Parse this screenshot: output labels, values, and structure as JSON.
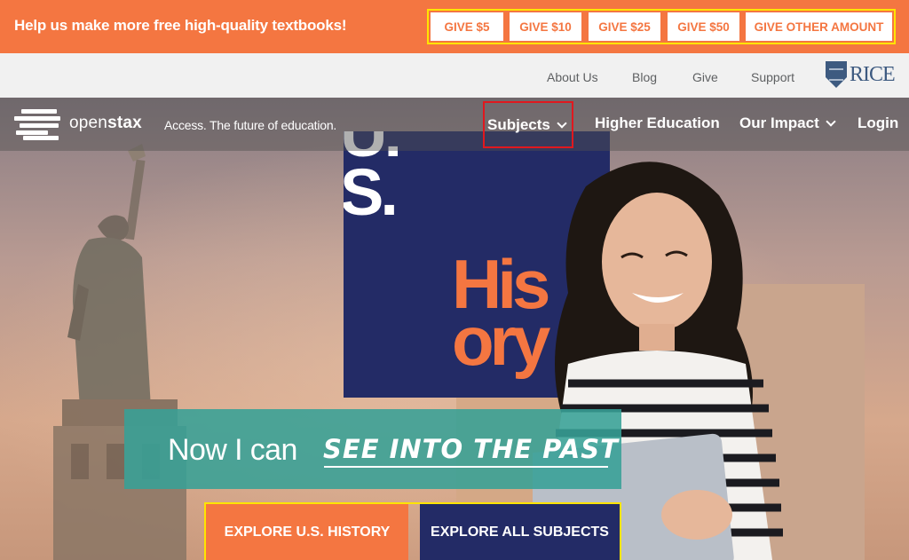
{
  "banner": {
    "message": "Help us make more free high-quality textbooks!",
    "give_buttons": [
      "GIVE $5",
      "GIVE $10",
      "GIVE $25",
      "GIVE $50",
      "GIVE OTHER AMOUNT"
    ]
  },
  "utility_nav": {
    "links": [
      "About Us",
      "Blog",
      "Give",
      "Support"
    ],
    "rice_logo_text": "RICE"
  },
  "main_nav": {
    "logo_text_light": "open",
    "logo_text_bold": "stax",
    "tagline": "Access. The future of education.",
    "items": {
      "subjects": "Subjects",
      "higher_ed": "Higher Education",
      "impact": "Our Impact",
      "login": "Login"
    }
  },
  "hero": {
    "book_title_line1": "U.",
    "book_title_line2": "S.",
    "book_title_line3": "His",
    "book_title_line4": "ory",
    "headline_prefix": "Now I can",
    "headline_emphasis": "SEE INTO THE PAST",
    "cta_primary": "EXPLORE U.S. HISTORY",
    "cta_secondary": "EXPLORE ALL SUBJECTS"
  },
  "colors": {
    "brand_orange": "#f47641",
    "brand_navy": "#232b66",
    "teal": "#37a096",
    "highlight_yellow": "#ffe400",
    "focus_red": "#e0181e"
  }
}
